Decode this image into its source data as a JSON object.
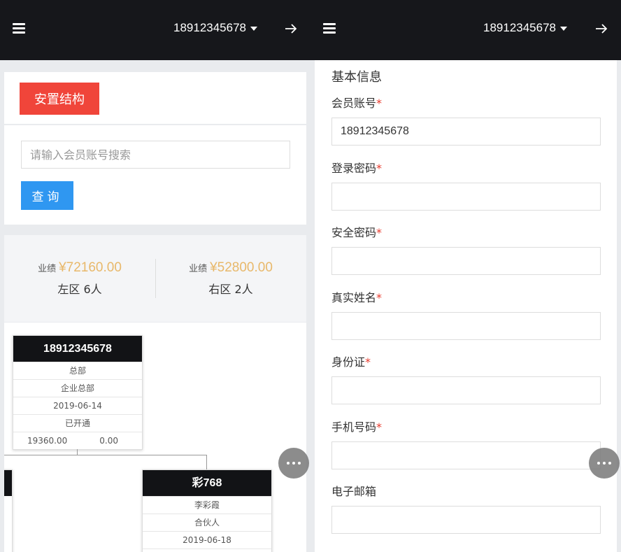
{
  "left": {
    "header": {
      "account": "18912345678"
    },
    "place_button": "安置结构",
    "search": {
      "placeholder": "请输入会员账号搜索",
      "value": ""
    },
    "query_button": "查询",
    "stats": {
      "left": {
        "label": "业绩",
        "amount": "¥72160.00",
        "zone": "左区 6人"
      },
      "right": {
        "label": "业绩",
        "amount": "¥52800.00",
        "zone": "右区 2人"
      }
    },
    "tree": {
      "root": {
        "title": "18912345678",
        "rows": [
          "总部",
          "企业总部",
          "2019-06-14",
          "已开通"
        ],
        "left_value": "19360.00",
        "right_value": "0.00"
      },
      "child": {
        "title": "彩768",
        "rows": [
          "李彩霞",
          "合伙人",
          "2019-06-18"
        ]
      }
    }
  },
  "right": {
    "header": {
      "account": "18912345678"
    },
    "form_title": "基本信息",
    "required_mark": "*",
    "fields": [
      {
        "label": "会员账号",
        "required": true,
        "value": "18912345678"
      },
      {
        "label": "登录密码",
        "required": true,
        "value": ""
      },
      {
        "label": "安全密码",
        "required": true,
        "value": ""
      },
      {
        "label": "真实姓名",
        "required": true,
        "value": ""
      },
      {
        "label": "身份证",
        "required": true,
        "value": ""
      },
      {
        "label": "手机号码",
        "required": true,
        "value": ""
      },
      {
        "label": "电子邮箱",
        "required": false,
        "value": ""
      }
    ]
  },
  "icons": {
    "menu": "hamburger-menu-icon",
    "logout": "arrow-right-icon",
    "dropdown": "caret-down-icon",
    "more": "more-dots-icon"
  },
  "colors": {
    "topbar": "#16171b",
    "place_button": "#f0453a",
    "query_button": "#2f97f1",
    "amount": "#e8b86a",
    "required": "#e83b2e"
  }
}
